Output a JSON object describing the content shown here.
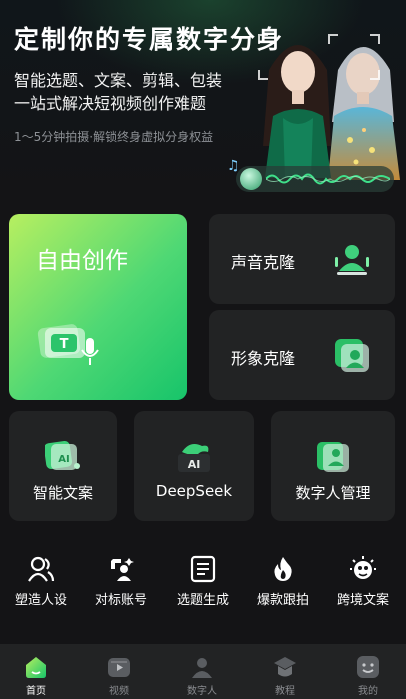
{
  "hero": {
    "title": "定制你的专属数字分身",
    "line1": "智能选题、文案、剪辑、包装",
    "line2": "一站式解决短视频创作难题",
    "tagline": "1～5分钟拍摄·解锁终身虚拟分身权益"
  },
  "cards": {
    "free_create": "自由创作",
    "voice_clone": "声音克隆",
    "image_clone": "形象克隆",
    "smart_copy": "智能文案",
    "deepseek": "DeepSeek",
    "deepseek_badge": "AI",
    "digital_human_mgmt": "数字人管理"
  },
  "tools": [
    {
      "label": "塑造人设",
      "icon": "persona-icon"
    },
    {
      "label": "对标账号",
      "icon": "benchmark-account-icon"
    },
    {
      "label": "选题生成",
      "icon": "topic-generate-icon"
    },
    {
      "label": "爆款跟拍",
      "icon": "flame-icon"
    },
    {
      "label": "跨境文案",
      "icon": "cross-border-icon"
    }
  ],
  "nav": [
    {
      "label": "首页",
      "active": true
    },
    {
      "label": "视频",
      "active": false
    },
    {
      "label": "数字人",
      "active": false
    },
    {
      "label": "教程",
      "active": false
    },
    {
      "label": "我的",
      "active": false
    }
  ],
  "colors": {
    "accent_green": "#22c76c",
    "background": "#141416",
    "card": "#222324"
  }
}
